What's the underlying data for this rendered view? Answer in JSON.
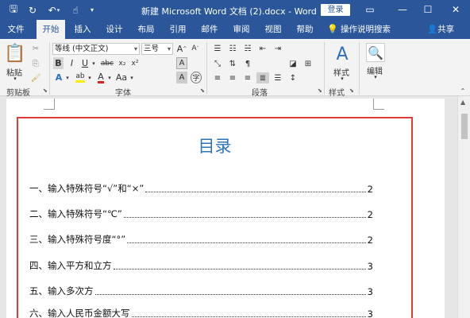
{
  "window": {
    "title": "新建 Microsoft Word 文档 (2).docx - Word",
    "login_label": "登录"
  },
  "tabs": [
    "文件",
    "开始",
    "插入",
    "设计",
    "布局",
    "引用",
    "邮件",
    "审阅",
    "视图",
    "帮助"
  ],
  "tell_me": "操作说明搜索",
  "share": "共享",
  "ribbon": {
    "clipboard": {
      "paste_label": "粘贴",
      "group_label": "剪贴板"
    },
    "font": {
      "font_name": "等线 (中文正文)",
      "font_size": "三号",
      "group_label": "字体",
      "bold": "B",
      "italic": "I",
      "underline": "U",
      "strike": "abc",
      "subscript": "x₂",
      "superscript": "x²",
      "grow": "A",
      "shrink": "A",
      "clear": "A",
      "phonetic": "wén",
      "text_effects": "A",
      "highlight": "ab",
      "font_color": "A",
      "char_shading": "A",
      "enclose": "字"
    },
    "paragraph": {
      "group_label": "段落"
    },
    "styles": {
      "label": "样式",
      "group_label": "样式"
    },
    "editing": {
      "label": "编辑"
    }
  },
  "document": {
    "toc_title": "目录",
    "entries": [
      {
        "text": "一、输入特殊符号“√”和“×”",
        "page": "2"
      },
      {
        "text": "二、输入特殊符号“℃”",
        "page": "2"
      },
      {
        "text": "三、输入特殊符号度“°”",
        "page": "2"
      },
      {
        "text": "四、输入平方和立方",
        "page": "3"
      },
      {
        "text": "五、输入多次方",
        "page": "3"
      },
      {
        "text": "六、输入人民币金额大写",
        "page": "3"
      }
    ]
  },
  "colors": {
    "title_bar": "#2b579a",
    "toc_title": "#2e74b5",
    "highlight_frame": "#e03c3c"
  }
}
